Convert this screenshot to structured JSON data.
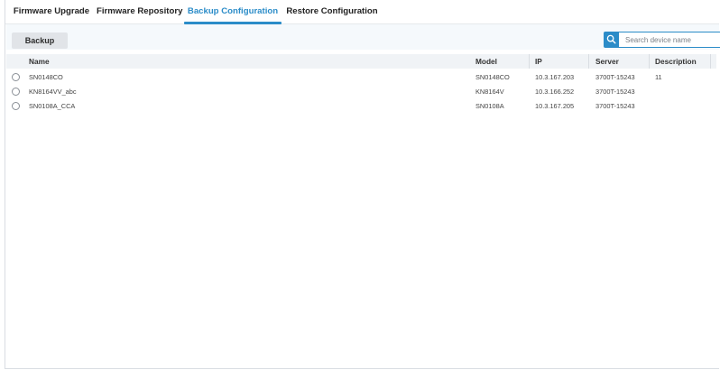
{
  "tabs": [
    {
      "label": "Firmware Upgrade",
      "active": false
    },
    {
      "label": "Firmware Repository",
      "active": false
    },
    {
      "label": "Backup Configuration",
      "active": true
    },
    {
      "label": "Restore Configuration",
      "active": false
    }
  ],
  "toolbar": {
    "backup_label": "Backup",
    "search_placeholder": "Search device name",
    "search_value": ""
  },
  "table": {
    "columns": [
      "Name",
      "Model",
      "IP",
      "Server",
      "Description"
    ],
    "rows": [
      {
        "name": "SN0148CO",
        "model": "SN0148CO",
        "ip": "10.3.167.203",
        "server": "3700T-15243",
        "description": "11",
        "selected": false
      },
      {
        "name": "KN8164VV_abc",
        "model": "KN8164V",
        "ip": "10.3.166.252",
        "server": "3700T-15243",
        "description": "",
        "selected": false
      },
      {
        "name": "SN0108A_CCA",
        "model": "SN0108A",
        "ip": "10.3.167.205",
        "server": "3700T-15243",
        "description": "",
        "selected": false
      }
    ]
  },
  "colors": {
    "accent": "#2b8cc8",
    "toolbar_bg": "#f5f9fc",
    "header_bg": "#f0f3f6",
    "button_bg": "#e1e4e8"
  },
  "icons": {
    "search": "search-icon",
    "row_select": "radio-icon"
  }
}
